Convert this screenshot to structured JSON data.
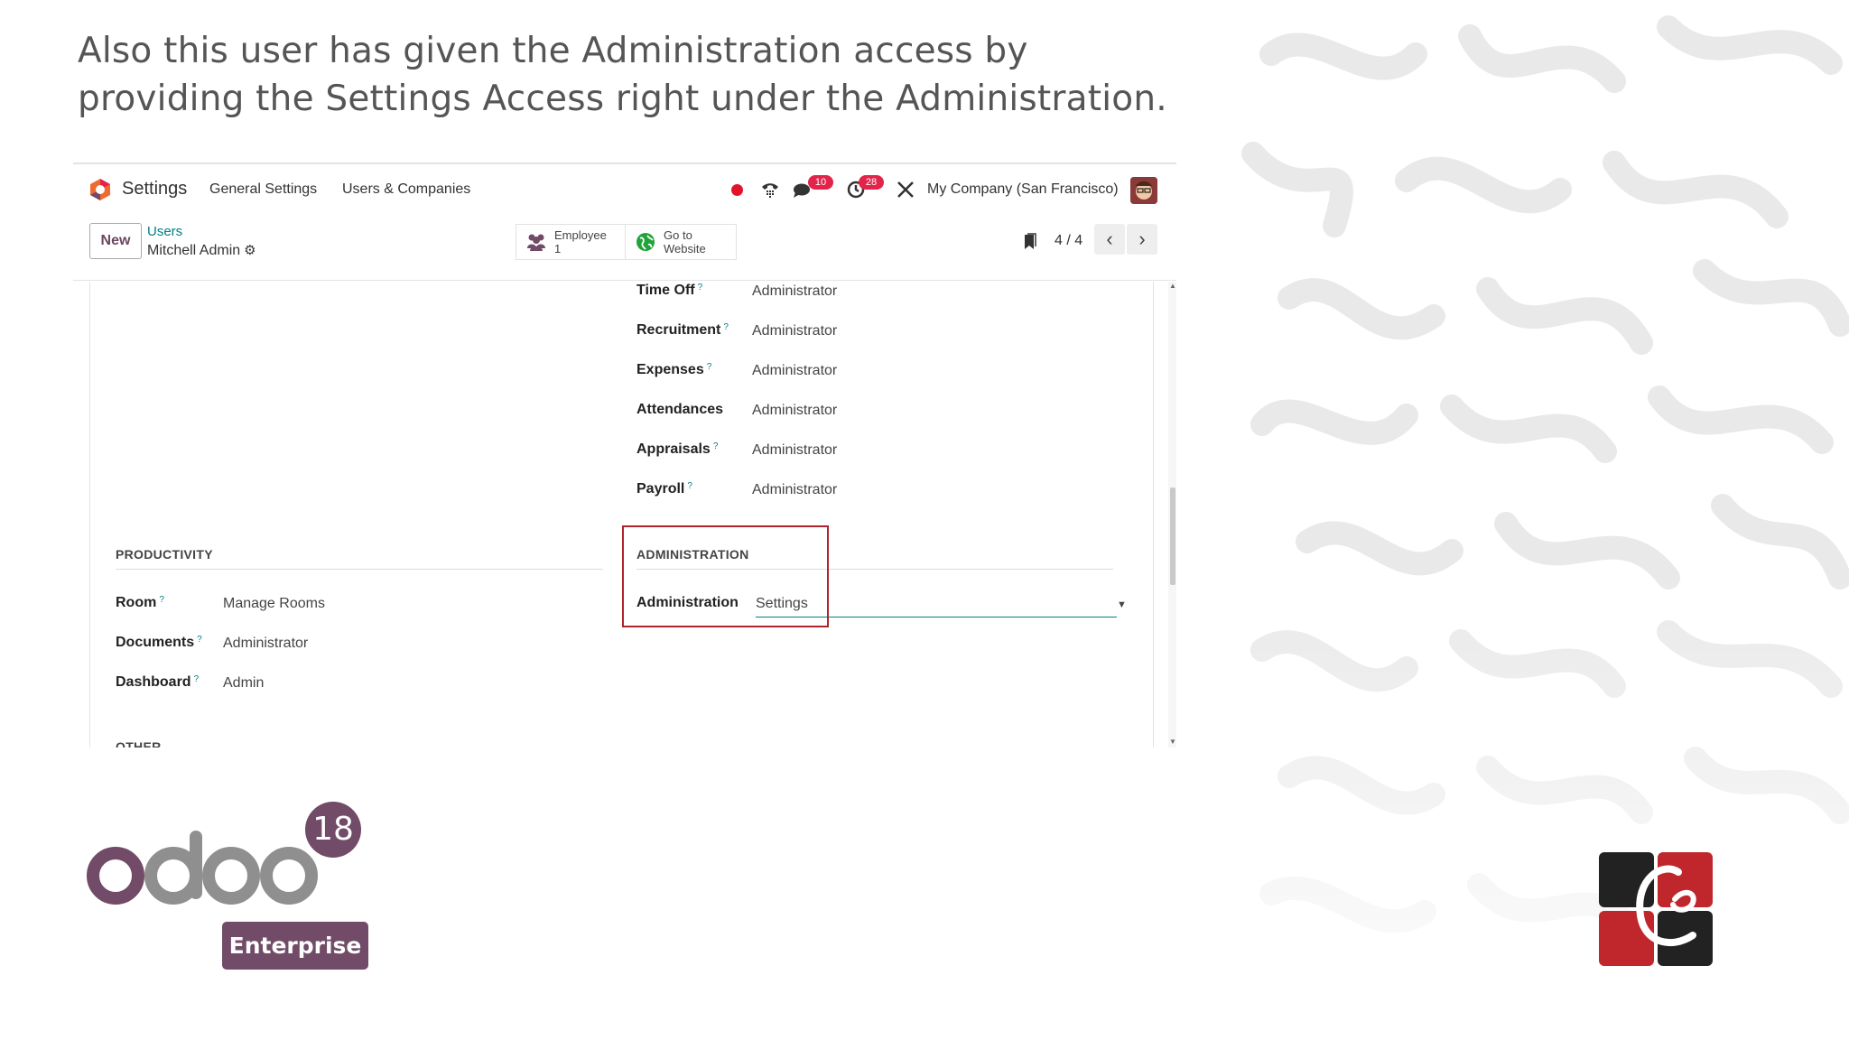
{
  "headline": "Also this user has given the Administration access by providing the Settings Access right under the Administration.",
  "navbar": {
    "app_name": "Settings",
    "links": [
      "General Settings",
      "Users & Companies"
    ],
    "chat_badge": "10",
    "activity_badge": "28",
    "company": "My Company (San Francisco)"
  },
  "controlbar": {
    "new_label": "New",
    "breadcrumb_parent": "Users",
    "breadcrumb_current": "Mitchell Admin",
    "smart_employee": {
      "label": "Employee",
      "count": "1"
    },
    "smart_website": {
      "line1": "Go to",
      "line2": "Website"
    },
    "pager": "4 / 4"
  },
  "form": {
    "hr_rows": [
      {
        "label": "Time Off",
        "value": "Administrator",
        "help": "?"
      },
      {
        "label": "Recruitment",
        "value": "Administrator",
        "help": "?"
      },
      {
        "label": "Expenses",
        "value": "Administrator",
        "help": "?"
      },
      {
        "label": "Attendances",
        "value": "Administrator",
        "help": ""
      },
      {
        "label": "Appraisals",
        "value": "Administrator",
        "help": "?"
      },
      {
        "label": "Payroll",
        "value": "Administrator",
        "help": "?"
      }
    ],
    "productivity": {
      "title": "PRODUCTIVITY",
      "rows": [
        {
          "label": "Room",
          "value": "Manage Rooms",
          "help": "?"
        },
        {
          "label": "Documents",
          "value": "Administrator",
          "help": "?"
        },
        {
          "label": "Dashboard",
          "value": "Admin",
          "help": "?"
        }
      ]
    },
    "administration": {
      "title": "ADMINISTRATION",
      "label": "Administration",
      "value": "Settings"
    },
    "cut_section": "OTHER"
  },
  "branding": {
    "version": "18",
    "edition": "Enterprise"
  },
  "colors": {
    "odoo_purple": "#714b67",
    "odoo_teal": "#017e84",
    "highlight_red": "#b0242b",
    "badge_red": "#e3244a"
  }
}
